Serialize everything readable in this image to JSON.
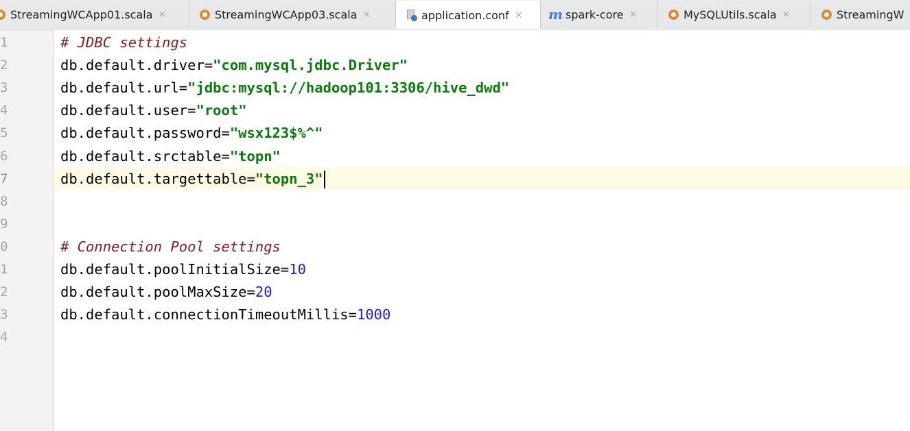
{
  "tabs": [
    {
      "label": "StreamingWCApp01.scala",
      "icon": "scala-file-icon",
      "active": false
    },
    {
      "label": "StreamingWCApp03.scala",
      "icon": "scala-file-icon",
      "active": false
    },
    {
      "label": "application.conf",
      "icon": "config-file-icon",
      "active": true
    },
    {
      "label": "spark-core",
      "icon": "maven-icon",
      "active": false
    },
    {
      "label": "MySQLUtils.scala",
      "icon": "scala-file-icon",
      "active": false
    },
    {
      "label": "StreamingW",
      "icon": "scala-file-icon",
      "active": false
    }
  ],
  "close_glyph": "×",
  "editor": {
    "line_numbers": [
      "1",
      "2",
      "3",
      "4",
      "5",
      "6",
      "7",
      "8",
      "9",
      "0",
      "1",
      "2",
      "3",
      "4"
    ],
    "current_line": 7,
    "lines": [
      {
        "comment": "# JDBC settings"
      },
      {
        "key": "db.default.driver=",
        "string": "\"com.mysql.jdbc.Driver\""
      },
      {
        "key": "db.default.url=",
        "string": "\"jdbc:mysql://hadoop101:3306/hive_dwd\""
      },
      {
        "key": "db.default.user=",
        "string": "\"root\""
      },
      {
        "key": "db.default.password=",
        "string": "\"wsx123$%^\""
      },
      {
        "key": "db.default.srctable=",
        "string": "\"topn\""
      },
      {
        "key": "db.default.targettable=",
        "string": "\"topn_3\""
      },
      {},
      {},
      {
        "comment": "# Connection Pool settings"
      },
      {
        "key": "db.default.poolInitialSize=",
        "number": "10"
      },
      {
        "key": "db.default.poolMaxSize=",
        "number": "20"
      },
      {
        "key": "db.default.connectionTimeoutMillis=",
        "number": "1000"
      },
      {}
    ]
  },
  "colors": {
    "comment": "#8c1c1c",
    "string": "#077d0a",
    "number": "#1a1aff",
    "current_line": "#fffae3"
  }
}
